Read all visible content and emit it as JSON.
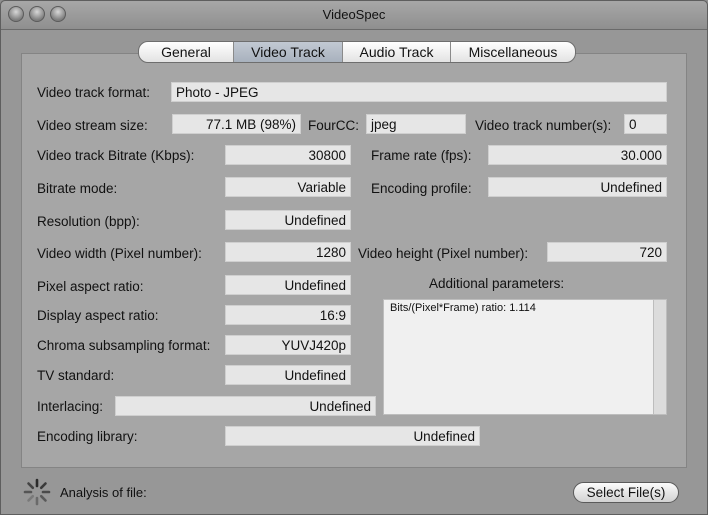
{
  "window": {
    "title": "VideoSpec"
  },
  "tabs": [
    {
      "label": "General",
      "active": false
    },
    {
      "label": "Video Track",
      "active": true
    },
    {
      "label": "Audio Track",
      "active": false
    },
    {
      "label": "Miscellaneous",
      "active": false
    }
  ],
  "fields": {
    "format": {
      "label": "Video track format:",
      "value": "Photo - JPEG"
    },
    "stream_size": {
      "label": "Video stream size:",
      "value": "77.1 MB (98%)"
    },
    "fourcc": {
      "label": "FourCC:",
      "value": "jpeg"
    },
    "track_number": {
      "label": "Video track number(s):",
      "value": "0"
    },
    "bitrate": {
      "label": "Video track Bitrate (Kbps):",
      "value": "30800"
    },
    "frame_rate": {
      "label": "Frame rate (fps):",
      "value": "30.000"
    },
    "bitrate_mode": {
      "label": "Bitrate mode:",
      "value": "Variable"
    },
    "encoding_profile": {
      "label": "Encoding profile:",
      "value": "Undefined"
    },
    "resolution": {
      "label": "Resolution (bpp):",
      "value": "Undefined"
    },
    "width": {
      "label": "Video width (Pixel number):",
      "value": "1280"
    },
    "height": {
      "label": "Video height (Pixel number):",
      "value": "720"
    },
    "pixel_aspect": {
      "label": "Pixel aspect ratio:",
      "value": "Undefined"
    },
    "display_aspect": {
      "label": "Display aspect ratio:",
      "value": "16:9"
    },
    "chroma": {
      "label": "Chroma subsampling format:",
      "value": "YUVJ420p"
    },
    "tv_standard": {
      "label": "TV standard:",
      "value": "Undefined"
    },
    "interlacing": {
      "label": "Interlacing:",
      "value": "Undefined"
    },
    "encoding_library": {
      "label": "Encoding library:",
      "value": "Undefined"
    }
  },
  "additional": {
    "label": "Additional parameters:",
    "text": "Bits/(Pixel*Frame) ratio: 1.114"
  },
  "footer": {
    "status_label": "Analysis of file:",
    "select_button": "Select File(s)"
  }
}
